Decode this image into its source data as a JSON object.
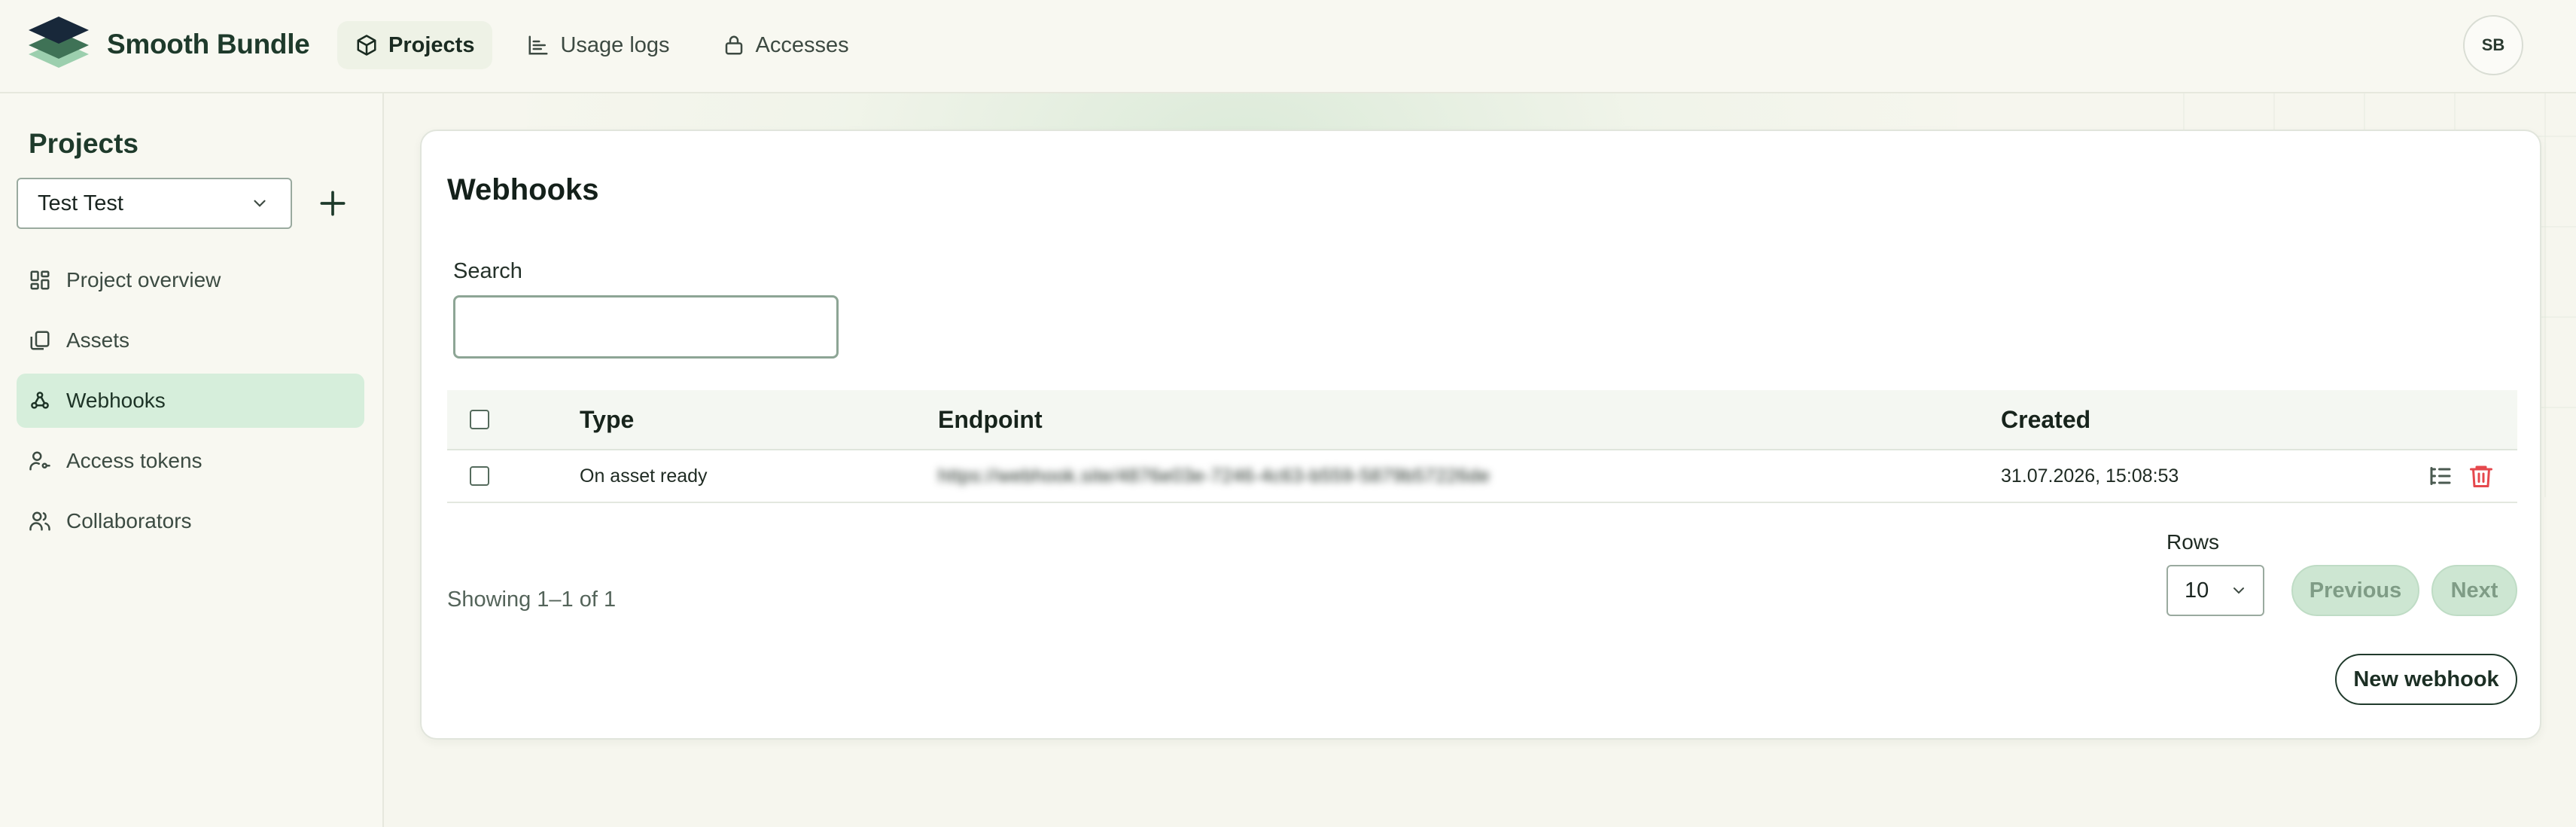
{
  "app": {
    "brand": "Smooth Bundle",
    "user_initials": "SB"
  },
  "nav": {
    "items": [
      {
        "label": "Projects",
        "icon": "box-icon",
        "active": true
      },
      {
        "label": "Usage logs",
        "icon": "chart-icon",
        "active": false
      },
      {
        "label": "Accesses",
        "icon": "lock-icon",
        "active": false
      }
    ]
  },
  "sidebar": {
    "title": "Projects",
    "project_select": "Test Test",
    "items": [
      {
        "label": "Project overview",
        "icon": "dashboard-icon"
      },
      {
        "label": "Assets",
        "icon": "files-icon"
      },
      {
        "label": "Webhooks",
        "icon": "webhook-icon",
        "active": true
      },
      {
        "label": "Access tokens",
        "icon": "user-key-icon"
      },
      {
        "label": "Collaborators",
        "icon": "users-icon"
      }
    ]
  },
  "main": {
    "title": "Webhooks",
    "search": {
      "label": "Search",
      "value": "",
      "placeholder": ""
    },
    "table": {
      "headers": {
        "type": "Type",
        "endpoint": "Endpoint",
        "created": "Created"
      },
      "rows": [
        {
          "type": "On asset ready",
          "endpoint": "https://webhook.site/4876e03e-7246-4c63-b559-5879b57226de",
          "created": "31.07.2026, 15:08:53"
        }
      ]
    },
    "pagination": {
      "showing": "Showing 1–1 of 1",
      "rows_label": "Rows",
      "rows_value": "10",
      "previous": "Previous",
      "next": "Next"
    },
    "new_webhook": "New webhook"
  },
  "colors": {
    "accent": "#d6eedb",
    "brand_dark": "#1e3a2b",
    "danger": "#e5484d",
    "disabled_button": "#cde6d2"
  }
}
